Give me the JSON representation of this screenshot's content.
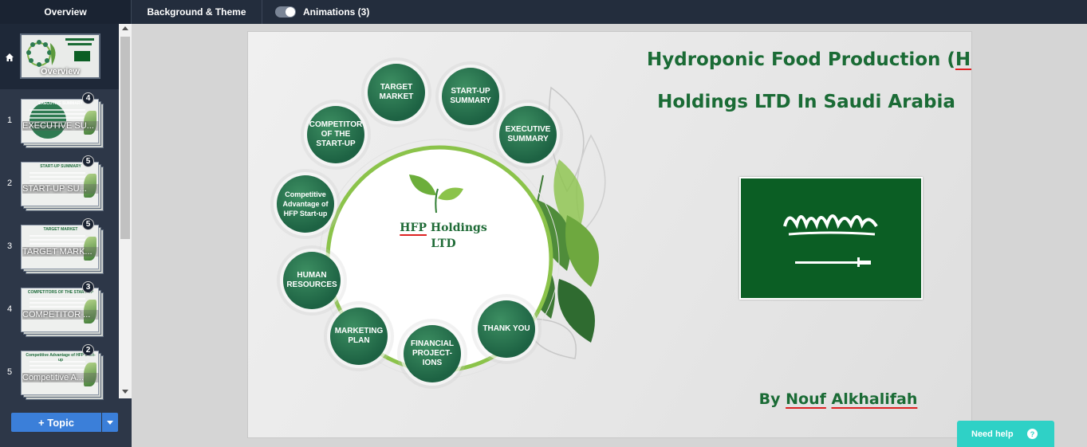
{
  "topbar": {
    "tab_overview": "Overview",
    "tab_background": "Background & Theme",
    "animations_label": "Animations (3)",
    "animations_on": true
  },
  "sidebar": {
    "overview_label": "Overview",
    "topics": [
      {
        "num": "1",
        "caption": "EXECUTIVE SU...",
        "badge": "4",
        "mini_title": "EXECUTIVE SUMMARY"
      },
      {
        "num": "2",
        "caption": "START-UP SU...",
        "badge": "5",
        "mini_title": "START-UP SUMMARY"
      },
      {
        "num": "3",
        "caption": "TARGET MARK...",
        "badge": "5",
        "mini_title": "TARGET MARKET"
      },
      {
        "num": "4",
        "caption": "COMPETITOR ...",
        "badge": "3",
        "mini_title": "COMPETITORS OF THE START-UP"
      },
      {
        "num": "5",
        "caption": "Competitive A...",
        "badge": "2",
        "mini_title": "Competitive Advantage of HFP Start-up"
      }
    ],
    "add_topic_label": "+ Topic"
  },
  "slide": {
    "title_line1_pre": "Hydroponic Food Production (",
    "title_line1_hfp": "HFP",
    "title_line1_post": ")",
    "title_line2": "Holdings LTD In Saudi Arabia",
    "byline_by": "By ",
    "byline_first": "Nouf",
    "byline_last": "Alkhalifah",
    "logo_line1_hfp": "HFP",
    "logo_line1_rest": " Holdings",
    "logo_line2": "LTD",
    "nodes": {
      "target_market": "TARGET MARKET",
      "startup_summary": "START-UP SUMMARY",
      "executive_summary": "EXECUTIVE SUMMARY",
      "competitor": "COMPETITOR OF THE START-UP",
      "competitive_advantage": "Competitive Advantage of HFP Start-up",
      "human_resources": "HUMAN RESOURCES",
      "marketing_plan": "MARKETING PLAN",
      "financial_projections": "FINANCIAL PROJECT-IONS",
      "thank_you": "THANK YOU"
    }
  },
  "help": {
    "label": "Need help",
    "icon": "?"
  },
  "colors": {
    "topbar": "#232d3d",
    "title_green": "#1a6b35",
    "node_green": "#1d6243",
    "flag_green": "#0b5e24",
    "help_teal": "#2fd1c6",
    "topic_blue": "#3b7fd9"
  }
}
